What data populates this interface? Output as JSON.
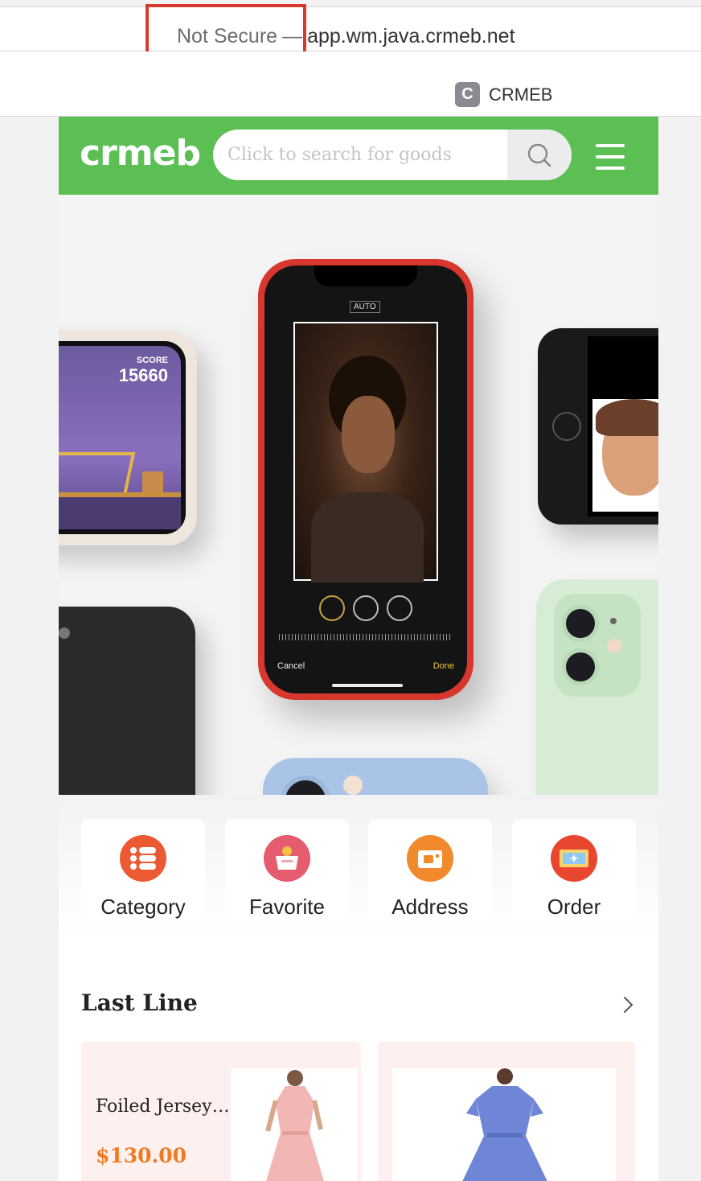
{
  "browser": {
    "security": "Not Secure",
    "separator": "—",
    "url": "app.wm.java.crmeb.net",
    "tab_favicon": "C",
    "tab_title": "CRMEB"
  },
  "header": {
    "logo": "crmeb",
    "search_placeholder": "Click to search for goods",
    "search_icon": "search-icon",
    "menu_icon": "menu-icon",
    "brand_color": "#5cbf54"
  },
  "banner": {
    "game_score_label": "SCORE",
    "game_score": "15660",
    "camera_mode": "AUTO",
    "cancel_label": "Cancel",
    "done_label": "Done"
  },
  "quick_nav": [
    {
      "label": "Category",
      "icon": "category-icon",
      "color": "#eb5a32"
    },
    {
      "label": "Favorite",
      "icon": "favorite-icon",
      "color": "#e45c6e"
    },
    {
      "label": "Address",
      "icon": "address-icon",
      "color": "#f08a2c"
    },
    {
      "label": "Order",
      "icon": "order-icon",
      "color": "#e8462e"
    }
  ],
  "last_line": {
    "title": "Last Line",
    "products": [
      {
        "name": "Foiled Jersey …",
        "price": "$130.00"
      },
      {
        "name": "",
        "price": ""
      }
    ]
  },
  "colors": {
    "price": "#f07a22",
    "highlight": "#d63a2c"
  }
}
